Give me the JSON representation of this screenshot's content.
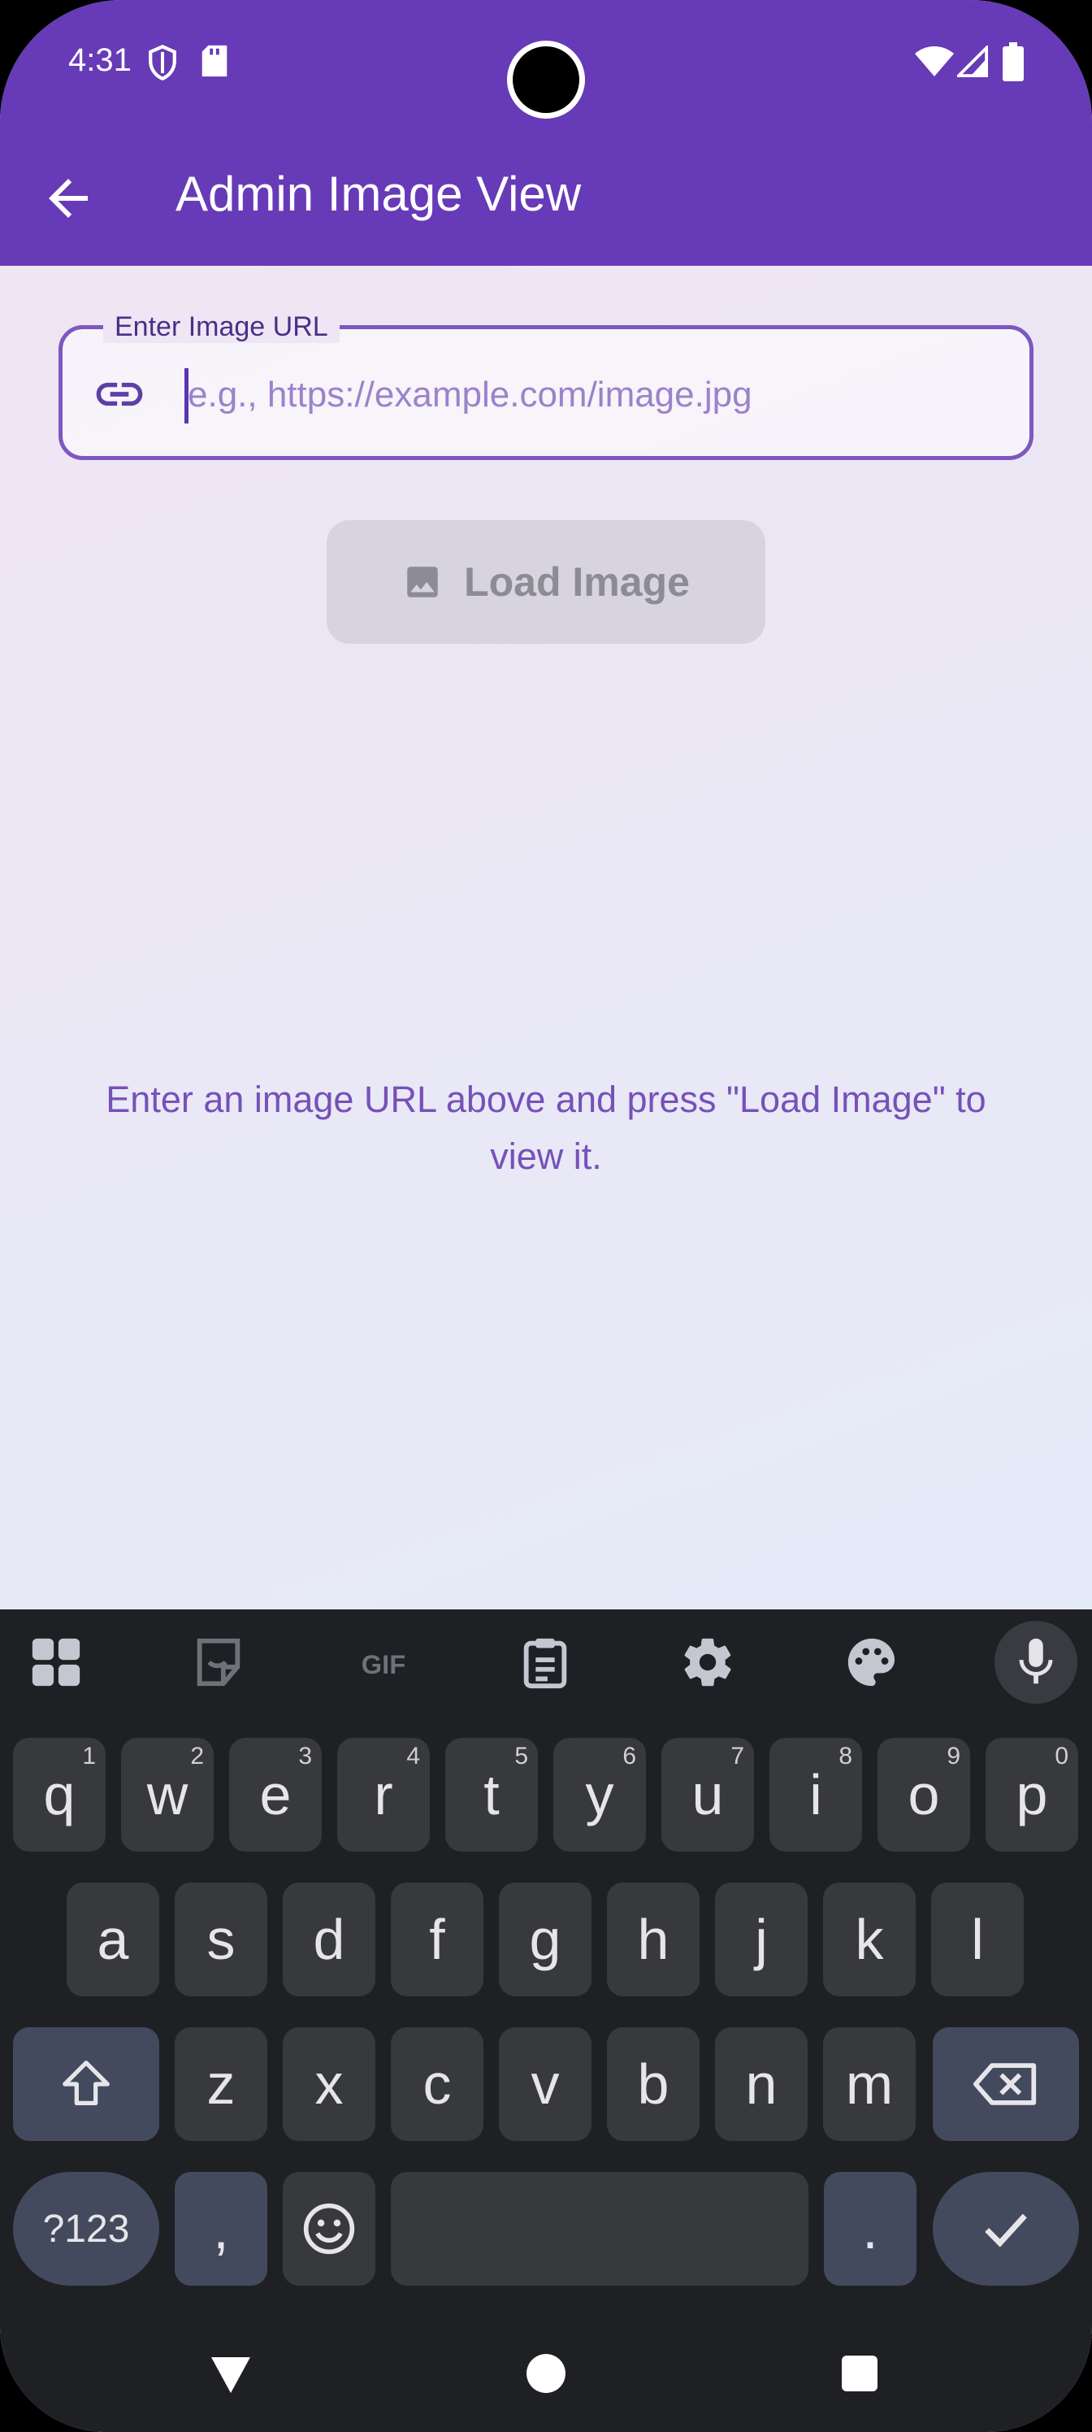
{
  "status_bar": {
    "time": "4:31"
  },
  "app_bar": {
    "title": "Admin Image View"
  },
  "url_field": {
    "label": "Enter Image URL",
    "placeholder": "e.g., https://example.com/image.jpg",
    "value": ""
  },
  "load_button": {
    "label": "Load Image",
    "enabled": false
  },
  "hint_text": "Enter an image URL above and press \"Load Image\" to view it.",
  "keyboard": {
    "toolbar": [
      "apps-icon",
      "sticker-icon",
      "gif-icon",
      "clipboard-icon",
      "settings-icon",
      "palette-icon",
      "mic-icon"
    ],
    "gif_label": "GIF",
    "row1": [
      {
        "k": "q",
        "n": "1"
      },
      {
        "k": "w",
        "n": "2"
      },
      {
        "k": "e",
        "n": "3"
      },
      {
        "k": "r",
        "n": "4"
      },
      {
        "k": "t",
        "n": "5"
      },
      {
        "k": "y",
        "n": "6"
      },
      {
        "k": "u",
        "n": "7"
      },
      {
        "k": "i",
        "n": "8"
      },
      {
        "k": "o",
        "n": "9"
      },
      {
        "k": "p",
        "n": "0"
      }
    ],
    "row2": [
      "a",
      "s",
      "d",
      "f",
      "g",
      "h",
      "j",
      "k",
      "l"
    ],
    "row3": [
      "z",
      "x",
      "c",
      "v",
      "b",
      "n",
      "m"
    ],
    "symbols_label": "?123",
    "comma_label": ",",
    "period_label": "."
  },
  "colors": {
    "app_bar": "#673ab7",
    "accent": "#7e57c2",
    "keyboard_bg": "#1f2024",
    "key_bg": "#38393d",
    "mod_key_bg": "#434a5e"
  }
}
